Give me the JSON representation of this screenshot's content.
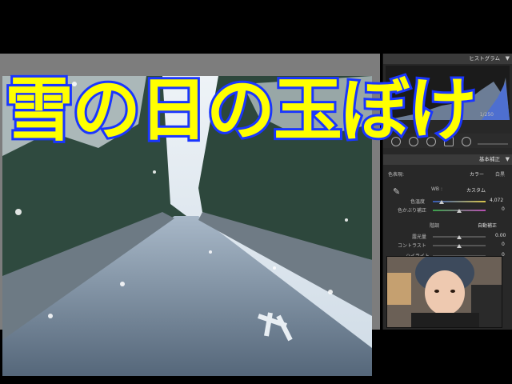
{
  "title_overlay": "雪の日の玉ぼけ",
  "panel": {
    "histogram_label": "ヒストグラム",
    "histogram_info": "1/250",
    "histogram_value": "f8",
    "basic_label": "基本補正",
    "profile_label": "色表現:",
    "profile_value": "カラー",
    "profile_alt": "白黒",
    "wb_label": "WB :",
    "wb_value": "カスタム",
    "temp_label": "色温度",
    "temp_value": "4,072",
    "tint_label": "色かぶり補正",
    "tint_value": "0",
    "tone_label": "階調",
    "auto_label": "自動補正",
    "exposure_label": "露光量",
    "exposure_value": "0.00",
    "contrast_label": "コントラスト",
    "contrast_value": "0",
    "highlight_label": "ハイライト",
    "highlight_value": "0"
  },
  "colors": {
    "title_fill": "#ffff00",
    "title_stroke": "#1a36ff",
    "panel_bg": "#282828",
    "canvas_bg": "#7d7d7d"
  }
}
